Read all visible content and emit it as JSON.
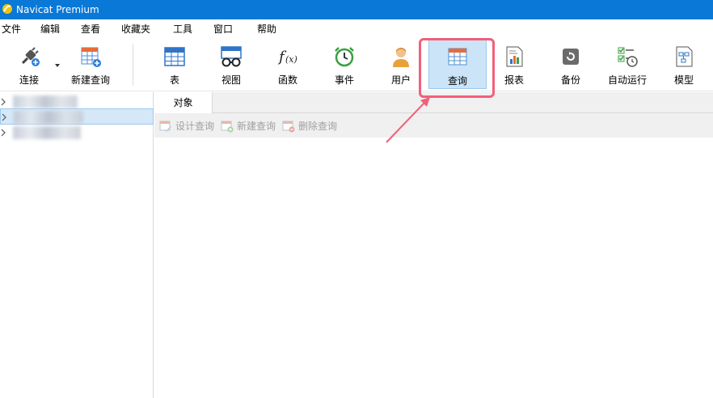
{
  "window": {
    "title": "Navicat Premium"
  },
  "menu": {
    "items": [
      "文件",
      "编辑",
      "查看",
      "收藏夹",
      "工具",
      "窗口",
      "帮助"
    ]
  },
  "toolbar": {
    "connect": "连接",
    "new_query": "新建查询",
    "table": "表",
    "view": "视图",
    "function": "函数",
    "event": "事件",
    "user": "用户",
    "query": "查询",
    "report": "报表",
    "backup": "备份",
    "automation": "自动运行",
    "model": "模型"
  },
  "tabs": {
    "objects": "对象"
  },
  "object_toolbar": {
    "design_query": "设计查询",
    "new_query": "新建查询",
    "delete_query": "删除查询"
  },
  "colors": {
    "titlebar": "#0a78d7",
    "highlight": "#f0607a",
    "active_bg": "#cce4f7"
  }
}
